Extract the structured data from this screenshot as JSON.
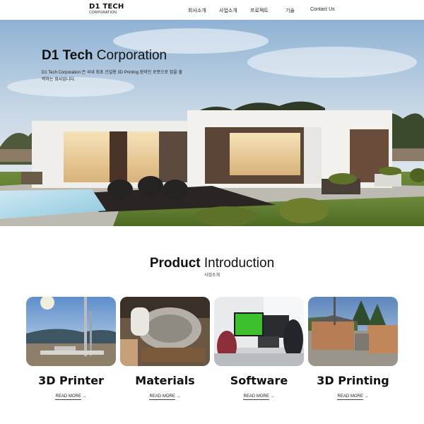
{
  "header": {
    "logo_main": "D1 TECH",
    "logo_sub": "CORPORATION",
    "nav": [
      "회사소개",
      "사업소개",
      "프로젝트",
      "기술",
      "Contact Us"
    ]
  },
  "hero": {
    "title_bold": "D1 Tech",
    "title_light": "Corporation",
    "description": "D1 Tech Corporation 은 국내 최초 건설용 3D Printing 장비인 로봇으로 집을 출력하는 회사입니다."
  },
  "products": {
    "title_bold": "Product",
    "title_light": "Introduction",
    "subtitle": "사업소개",
    "items": [
      {
        "title": "3D Printer",
        "link": "READ MORE"
      },
      {
        "title": "Materials",
        "link": "READ MORE"
      },
      {
        "title": "Software",
        "link": "READ MORE"
      },
      {
        "title": "3D Printing",
        "link": "READ MORE"
      }
    ],
    "arrow": "→"
  }
}
